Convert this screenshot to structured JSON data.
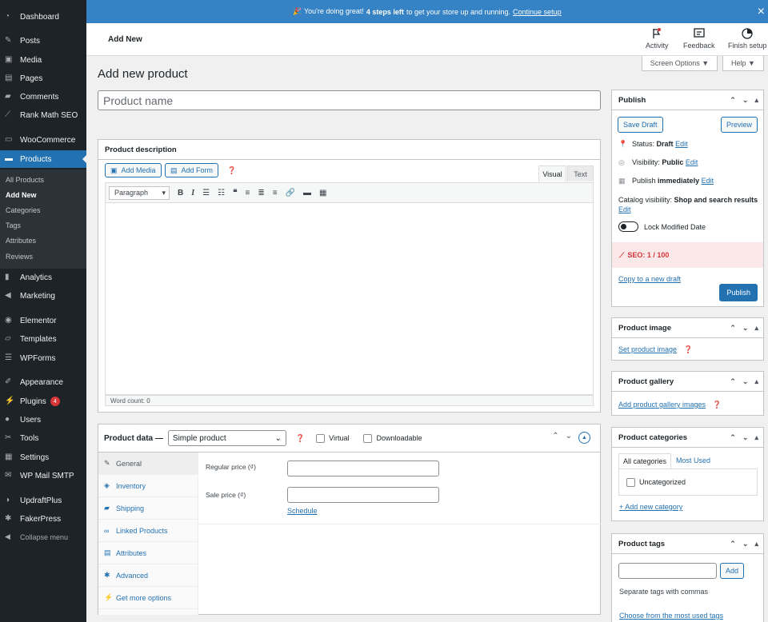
{
  "sidebar": {
    "items": [
      {
        "label": "Dashboard",
        "icon": "dashboard-icon"
      },
      {
        "label": "Posts",
        "icon": "pin-icon"
      },
      {
        "label": "Media",
        "icon": "media-icon"
      },
      {
        "label": "Pages",
        "icon": "page-icon"
      },
      {
        "label": "Comments",
        "icon": "comment-icon"
      },
      {
        "label": "Rank Math SEO",
        "icon": "rankmath-icon"
      },
      {
        "label": "WooCommerce",
        "icon": "woo-icon"
      },
      {
        "label": "Products",
        "icon": "products-icon"
      },
      {
        "label": "Analytics",
        "icon": "chart-icon"
      },
      {
        "label": "Marketing",
        "icon": "megaphone-icon"
      },
      {
        "label": "Elementor",
        "icon": "elementor-icon"
      },
      {
        "label": "Templates",
        "icon": "folder-icon"
      },
      {
        "label": "WPForms",
        "icon": "forms-icon"
      },
      {
        "label": "Appearance",
        "icon": "brush-icon"
      },
      {
        "label": "Plugins",
        "icon": "plugin-icon",
        "badge": "4"
      },
      {
        "label": "Users",
        "icon": "user-icon"
      },
      {
        "label": "Tools",
        "icon": "wrench-icon"
      },
      {
        "label": "Settings",
        "icon": "settings-icon"
      },
      {
        "label": "WP Mail SMTP",
        "icon": "mail-icon"
      },
      {
        "label": "UpdraftPlus",
        "icon": "updraft-icon"
      },
      {
        "label": "FakerPress",
        "icon": "star-icon"
      },
      {
        "label": "Collapse menu",
        "icon": "collapse-icon"
      }
    ],
    "submenu": [
      "All Products",
      "Add New",
      "Categories",
      "Tags",
      "Attributes",
      "Reviews"
    ]
  },
  "notice": {
    "prefix": "🎉 You're doing great!",
    "bold": "4 steps left",
    "suffix": "to get your store up and running.",
    "link": "Continue setup"
  },
  "header": {
    "title": "Add New",
    "activity": "Activity",
    "feedback": "Feedback",
    "finish": "Finish setup",
    "screen_options": "Screen Options ▼",
    "help": "Help ▼"
  },
  "page": {
    "title": "Add new product",
    "name_placeholder": "Product name"
  },
  "description": {
    "title": "Product description",
    "add_media": "Add Media",
    "add_form": "Add Form",
    "tab_visual": "Visual",
    "tab_text": "Text",
    "format": "Paragraph",
    "word_count": "Word count: 0"
  },
  "product_data": {
    "title": "Product data —",
    "type": "Simple product",
    "virtual": "Virtual",
    "downloadable": "Downloadable",
    "tabs": [
      "General",
      "Inventory",
      "Shipping",
      "Linked Products",
      "Attributes",
      "Advanced",
      "Get more options"
    ],
    "regular_price": "Regular price (₫)",
    "sale_price": "Sale price (₫)",
    "schedule": "Schedule"
  },
  "publish": {
    "title": "Publish",
    "save_draft": "Save Draft",
    "preview": "Preview",
    "status_label": "Status:",
    "status_value": "Draft",
    "visibility_label": "Visibility:",
    "visibility_value": "Public",
    "publish_label": "Publish",
    "publish_value": "immediately",
    "edit": "Edit",
    "catalog_label": "Catalog visibility:",
    "catalog_value": "Shop and search results",
    "lock_modified": "Lock Modified Date",
    "seo": "SEO: 1 / 100",
    "copy_draft": "Copy to a new draft",
    "publish_button": "Publish"
  },
  "product_image": {
    "title": "Product image",
    "link": "Set product image"
  },
  "product_gallery": {
    "title": "Product gallery",
    "link": "Add product gallery images"
  },
  "categories": {
    "title": "Product categories",
    "tab_all": "All categories",
    "tab_used": "Most Used",
    "item": "Uncategorized",
    "add_link": "+ Add new category"
  },
  "tags": {
    "title": "Product tags",
    "add": "Add",
    "hint": "Separate tags with commas",
    "choose": "Choose from the most used tags"
  },
  "colors": {
    "accent": "#2271b1",
    "sidebar": "#1d2327",
    "notice": "#3582c4",
    "seo_bg": "#fbe9e9",
    "seo_text": "#d63638"
  }
}
